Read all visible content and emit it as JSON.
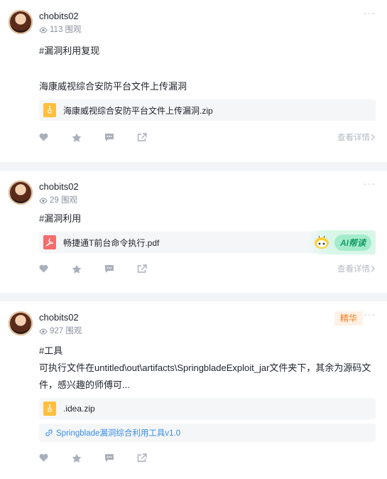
{
  "posts": [
    {
      "user": "chobits02",
      "views": "113 围观",
      "tag": "#漏洞利用复现",
      "text": "海康威视综合安防平台文件上传漏洞",
      "file": "海康威视综合安防平台文件上传漏洞.zip",
      "file_type": "zip-icon",
      "detail": "查看详情"
    },
    {
      "user": "chobits02",
      "views": "29 围观",
      "tag": "#漏洞利用",
      "file": "畅捷通T前台命令执行.pdf",
      "file_type": "pdf-icon",
      "ai_label": "AI帮读",
      "detail": "查看详情"
    },
    {
      "user": "chobits02",
      "views": "927 围观",
      "badge": "精华",
      "tag": "#工具",
      "text_line1": "可执行文件在untitled\\out\\artifacts\\SpringbladeExploit_jar文件夹下，其余为源码文",
      "text_line2": "件，感兴趣的师傅可...",
      "file": ".idea.zip",
      "file_type": "zip-icon",
      "link": "Springblade漏洞综合利用工具v1.0"
    }
  ],
  "more_glyph": "···",
  "colors": {
    "accent_link": "#3a8ee6",
    "badge_bg": "#fff1e5",
    "badge_text": "#f57a1f",
    "zip_icon": "#ffbf3c",
    "pdf_icon": "#f56c6c",
    "ai_green": "#1a9e67"
  }
}
